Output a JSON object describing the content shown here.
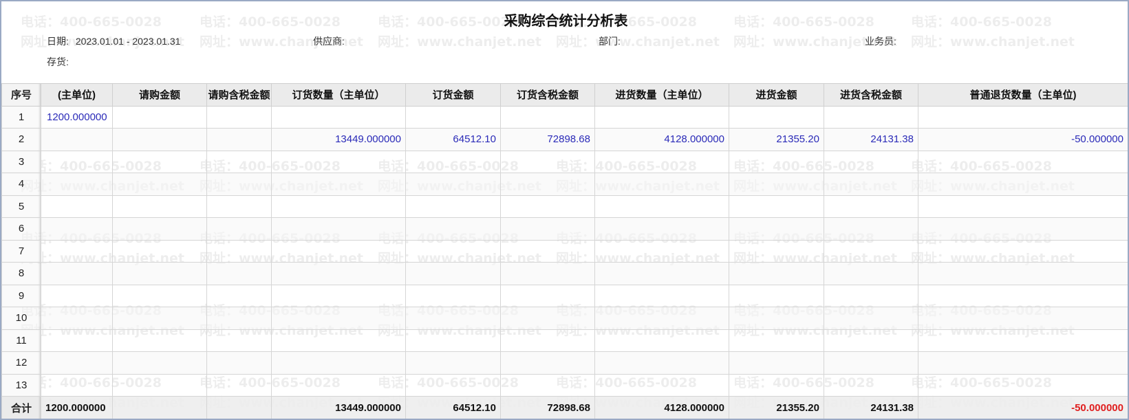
{
  "report": {
    "title": "采购综合统计分析表",
    "filters": {
      "date_label": "日期:",
      "date_value": "2023.01.01 - 2023.01.31",
      "supplier_label": "供应商:",
      "supplier_value": "",
      "department_label": "部门:",
      "department_value": "",
      "salesperson_label": "业务员:",
      "salesperson_value": "",
      "inventory_label": "存货:",
      "inventory_value": ""
    }
  },
  "watermark": {
    "phone": "电话：400-665-0028",
    "site": "网址：www.chanjet.net"
  },
  "table": {
    "columns": [
      "序号",
      "(主单位)",
      "请购金额",
      "请购含税金额",
      "订货数量（主单位）",
      "订货金额",
      "订货含税金额",
      "进货数量（主单位）",
      "进货金额",
      "进货含税金额",
      "普通退货数量（主单位)"
    ],
    "rows": [
      [
        "1",
        "1200.000000",
        "",
        "",
        "",
        "",
        "",
        "",
        "",
        "",
        ""
      ],
      [
        "2",
        "",
        "",
        "",
        "13449.000000",
        "64512.10",
        "72898.68",
        "4128.000000",
        "21355.20",
        "24131.38",
        "-50.000000"
      ],
      [
        "3",
        "",
        "",
        "",
        "",
        "",
        "",
        "",
        "",
        "",
        ""
      ],
      [
        "4",
        "",
        "",
        "",
        "",
        "",
        "",
        "",
        "",
        "",
        ""
      ],
      [
        "5",
        "",
        "",
        "",
        "",
        "",
        "",
        "",
        "",
        "",
        ""
      ],
      [
        "6",
        "",
        "",
        "",
        "",
        "",
        "",
        "",
        "",
        "",
        ""
      ],
      [
        "7",
        "",
        "",
        "",
        "",
        "",
        "",
        "",
        "",
        "",
        ""
      ],
      [
        "8",
        "",
        "",
        "",
        "",
        "",
        "",
        "",
        "",
        "",
        ""
      ],
      [
        "9",
        "",
        "",
        "",
        "",
        "",
        "",
        "",
        "",
        "",
        ""
      ],
      [
        "10",
        "",
        "",
        "",
        "",
        "",
        "",
        "",
        "",
        "",
        ""
      ],
      [
        "11",
        "",
        "",
        "",
        "",
        "",
        "",
        "",
        "",
        "",
        ""
      ],
      [
        "12",
        "",
        "",
        "",
        "",
        "",
        "",
        "",
        "",
        "",
        ""
      ],
      [
        "13",
        "",
        "",
        "",
        "",
        "",
        "",
        "",
        "",
        "",
        ""
      ]
    ],
    "totals": [
      "合计",
      "1200.000000",
      "",
      "",
      "13449.000000",
      "64512.10",
      "72898.68",
      "4128.000000",
      "21355.20",
      "24131.38",
      "-50.000000"
    ]
  },
  "colors": {
    "value_text": "#2a2ab8",
    "negative_total": "#e02020",
    "frame_border": "#9aa9c4"
  }
}
